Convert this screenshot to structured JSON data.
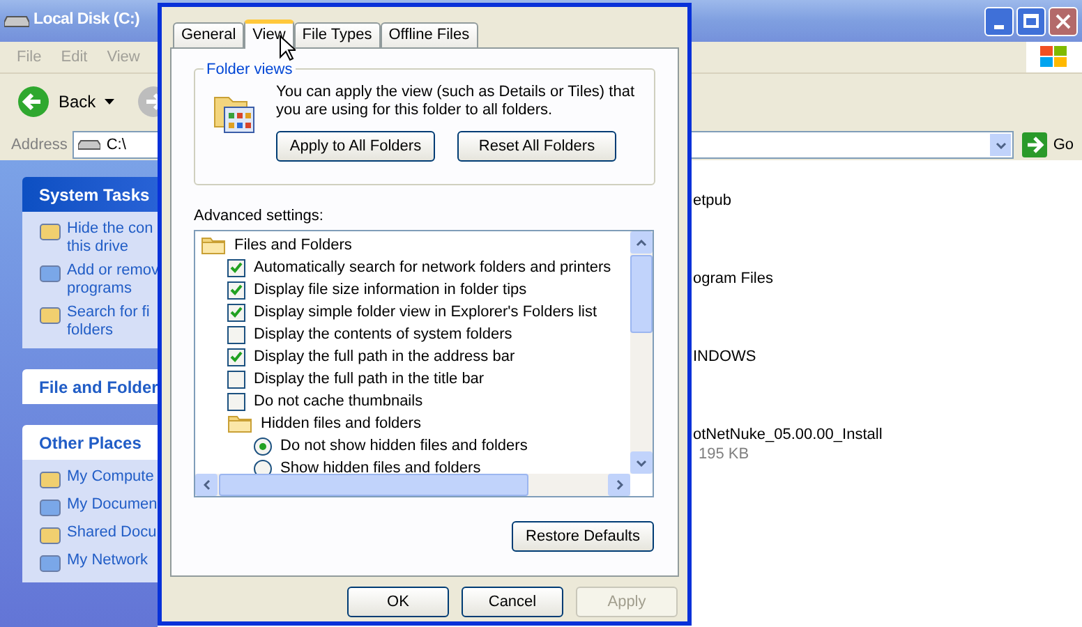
{
  "explorer": {
    "title": "Local Disk (C:)",
    "menu": [
      "File",
      "Edit",
      "View"
    ],
    "back_label": "Back",
    "address_label": "Address",
    "address_value": "C:\\",
    "go_label": "Go",
    "task_panels": [
      {
        "title": "System Tasks",
        "kind": "special",
        "items": [
          [
            "Hide the con",
            "this drive"
          ],
          [
            "Add or remov",
            "programs"
          ],
          [
            "Search for fi",
            "folders"
          ]
        ]
      },
      {
        "title": "File and Folder",
        "kind": "plain"
      },
      {
        "title": "Other Places",
        "kind": "plain",
        "items": [
          [
            "My Compute"
          ],
          [
            "My Documen"
          ],
          [
            "Shared Docu"
          ],
          [
            "My Network"
          ]
        ]
      }
    ],
    "files": [
      {
        "name": "etpub"
      },
      {
        "name": "ogram Files"
      },
      {
        "name": "INDOWS"
      },
      {
        "name": "otNetNuke_05.00.00_Install",
        "detail": "195 KB"
      }
    ]
  },
  "dialog": {
    "tabs": [
      {
        "label": "General",
        "selected": false
      },
      {
        "label": "View",
        "selected": true
      },
      {
        "label": "File Types",
        "selected": false
      },
      {
        "label": "Offline Files",
        "selected": false
      }
    ],
    "folder_views": {
      "title": "Folder views",
      "text": "You can apply the view (such as Details or Tiles) that you are using for this folder to all folders.",
      "buttons": [
        "Apply to All Folders",
        "Reset All Folders"
      ]
    },
    "advanced_label": "Advanced settings:",
    "settings": [
      {
        "kind": "folder",
        "label": "Files and Folders",
        "children": [
          {
            "kind": "checkbox",
            "label": "Automatically search for network folders and printers",
            "checked": true
          },
          {
            "kind": "checkbox",
            "label": "Display file size information in folder tips",
            "checked": true
          },
          {
            "kind": "checkbox",
            "label": "Display simple folder view in Explorer's Folders list",
            "checked": true
          },
          {
            "kind": "checkbox",
            "label": "Display the contents of system folders",
            "checked": false
          },
          {
            "kind": "checkbox",
            "label": "Display the full path in the address bar",
            "checked": true
          },
          {
            "kind": "checkbox",
            "label": "Display the full path in the title bar",
            "checked": false
          },
          {
            "kind": "checkbox",
            "label": "Do not cache thumbnails",
            "checked": false
          },
          {
            "kind": "folder",
            "label": "Hidden files and folders",
            "children": [
              {
                "kind": "radio",
                "label": "Do not show hidden files and folders",
                "selected": true
              },
              {
                "kind": "radio",
                "label": "Show hidden files and folders",
                "selected": false
              }
            ]
          }
        ]
      }
    ],
    "restore_label": "Restore Defaults",
    "footer_buttons": [
      {
        "label": "OK",
        "disabled": false
      },
      {
        "label": "Cancel",
        "disabled": false
      },
      {
        "label": "Apply",
        "disabled": true
      }
    ]
  }
}
